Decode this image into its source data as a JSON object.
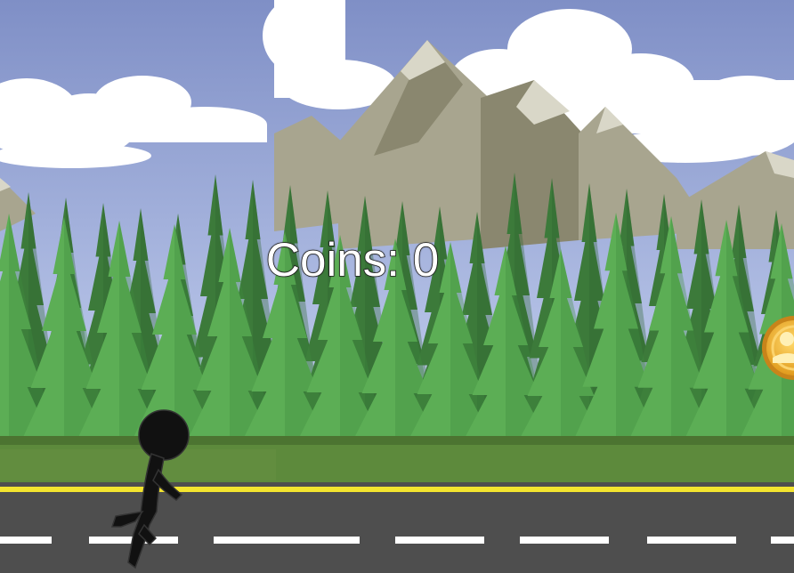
{
  "hud": {
    "coins_label": "Coins:",
    "coins_value": 0,
    "coins_text": "Coins: 0"
  },
  "colors": {
    "sky_top": "#7f8fc6",
    "sky_bottom": "#b8c7ec",
    "cloud": "#ffffff",
    "mountain_light": "#a8a58f",
    "mountain_dark": "#8a876f",
    "snow": "#d9d7c8",
    "tree_dark": "#3c7a3a",
    "tree_mid": "#4b9447",
    "tree_light": "#5cae55",
    "grass": "#5d8a3c",
    "road": "#4e4e4e",
    "road_line_yellow": "#f3e42f",
    "road_line_white": "#ffffff",
    "player": "#111111",
    "coin": "#f1b532"
  },
  "sprites": {
    "player": "stickman-runner",
    "pickup": "gold-coin"
  }
}
